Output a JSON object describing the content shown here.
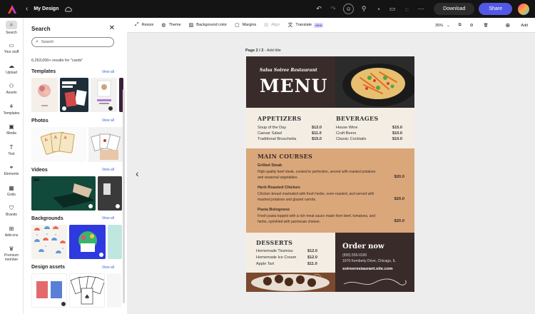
{
  "topbar": {
    "doc_name": "My Design",
    "download_label": "Download",
    "share_label": "Share"
  },
  "rail": {
    "items": [
      {
        "label": "Search",
        "icon": "search-icon"
      },
      {
        "label": "Your stuff",
        "icon": "folder-icon"
      },
      {
        "label": "Upload",
        "icon": "upload-icon"
      },
      {
        "label": "Assets",
        "icon": "assets-icon"
      },
      {
        "label": "Templates",
        "icon": "templates-icon"
      },
      {
        "label": "Media",
        "icon": "media-icon"
      },
      {
        "label": "Text",
        "icon": "text-icon"
      },
      {
        "label": "Elements",
        "icon": "elements-icon"
      },
      {
        "label": "Grids",
        "icon": "grid-icon"
      },
      {
        "label": "Brands",
        "icon": "brand-icon"
      },
      {
        "label": "Add-ons",
        "icon": "addons-icon"
      },
      {
        "label": "Premium",
        "label2": "member",
        "icon": "crown-icon"
      }
    ]
  },
  "panel": {
    "title": "Search",
    "search_placeholder": "Search",
    "results": "6,263,000+ results for \"cards\"",
    "sections": {
      "templates": "Templates",
      "photos": "Photos",
      "videos": "Videos",
      "backgrounds": "Backgrounds",
      "design_assets": "Design assets"
    },
    "view_all": "View all"
  },
  "toolbar": {
    "resize": "Resize",
    "theme": "Theme",
    "background_color": "Background color",
    "margins": "Margins",
    "align": "Align",
    "translate": "Translate",
    "new_badge": "NEW",
    "zoom": "35%",
    "add": "Add"
  },
  "page": {
    "label_prefix": "Page 2 / 2",
    "label_suffix": " - Add title"
  },
  "menu": {
    "restaurant": "Salsa Soiree Restaurant",
    "title": "MENU",
    "appetizers_title": "APPETIZERS",
    "appetizers": [
      {
        "name": "Soup of the Day",
        "price": "$12.0"
      },
      {
        "name": "Caesar Salad",
        "price": "$11.0"
      },
      {
        "name": "Traditional Bruschetta",
        "price": "$15.0"
      }
    ],
    "beverages_title": "BEVERAGES",
    "beverages": [
      {
        "name": "House Wine",
        "price": "$15.0"
      },
      {
        "name": "Craft Beers",
        "price": "$10.0"
      },
      {
        "name": "Classic Cocktails",
        "price": "$10.0"
      }
    ],
    "mains_title": "MAIN COURSES",
    "mains": [
      {
        "name": "Grilled Steak",
        "desc": "High-quality beef steak, cooked to perfection, served with roasted potatoes and seasonal vegetables.",
        "price": "$20.0"
      },
      {
        "name": "Herb Roasted Chicken",
        "desc": "Chicken breast marinated with fresh herbs, oven-roasted, and served with mashed potatoes and glazed carrots.",
        "price": "$20.0"
      },
      {
        "name": "Pasta Bolognese",
        "desc": "Fresh pasta topped with a rich meat sauce made from beef, tomatoes, and herbs, sprinkled with parmesan cheese.",
        "price": "$20.0"
      }
    ],
    "desserts_title": "DESSERTS",
    "desserts": [
      {
        "name": "Homemade Tiramisu",
        "price": "$12.0"
      },
      {
        "name": "Homemade Ice Cream",
        "price": "$12.0"
      },
      {
        "name": "Apple Tart",
        "price": "$11.0"
      }
    ],
    "order_title": "Order now",
    "phone": "(555) 555-0100",
    "address": "1676 Kemberly Drive, Chicago, IL",
    "website": "soireerestaurant.site.com"
  },
  "colors": {
    "accent": "#5258e4",
    "menu_dark": "#3a2b2b",
    "menu_tan": "#d9a77a",
    "menu_cream": "#f3ede4"
  }
}
